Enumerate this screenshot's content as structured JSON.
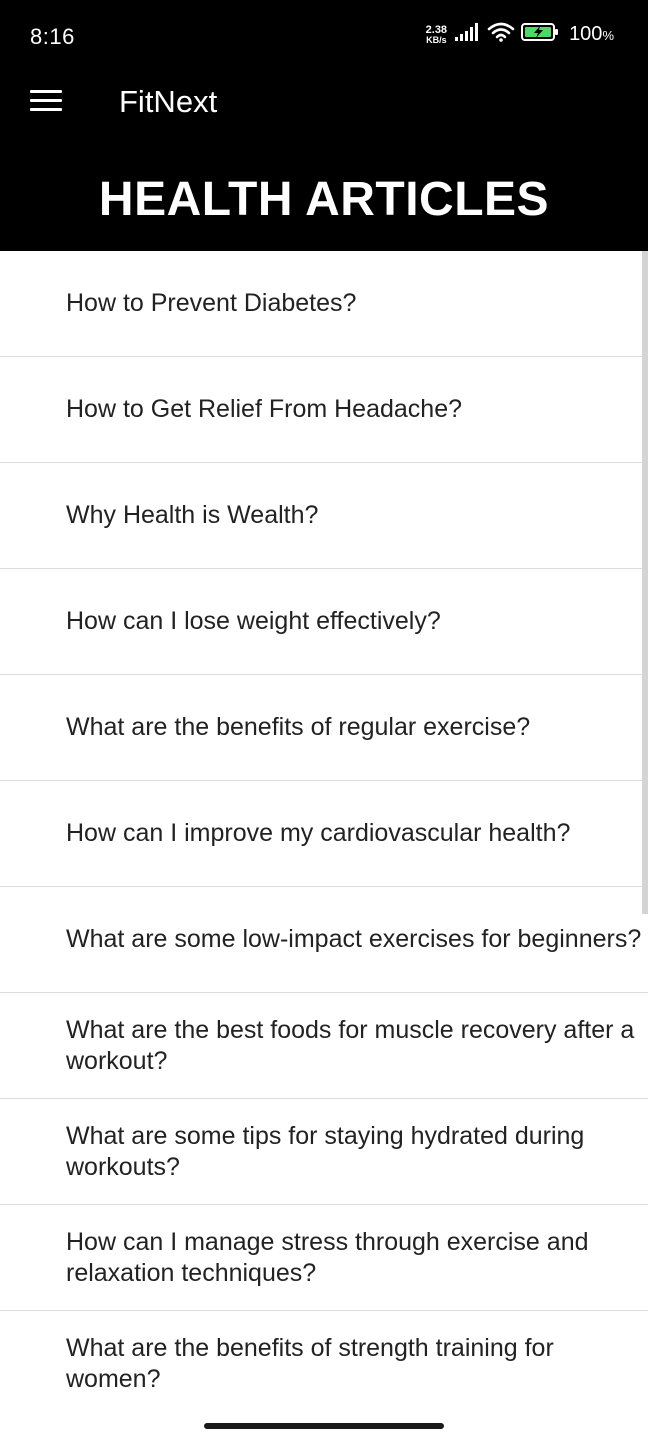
{
  "status_bar": {
    "time": "8:16",
    "net_speed_value": "2.38",
    "net_speed_unit": "KB/s",
    "battery_percent": "100",
    "battery_unit": "%",
    "icons": [
      "signal-icon",
      "wifi-icon",
      "battery-charging-icon"
    ]
  },
  "app_bar": {
    "menu_icon": "hamburger-menu-icon",
    "title": "FitNext"
  },
  "page": {
    "heading": "HEALTH ARTICLES"
  },
  "articles": [
    "How to Prevent Diabetes?",
    "How to Get Relief From Headache?",
    "Why Health is Wealth?",
    "How can I lose weight effectively?",
    "What are the benefits of regular exercise?",
    "How can I improve my cardiovascular health?",
    "What are some low-impact exercises for beginners?",
    "What are the best foods for muscle recovery after a workout?",
    "What are some tips for staying hydrated during workouts?",
    "How can I manage stress through exercise and relaxation techniques?",
    "What are the benefits of strength training for women?"
  ],
  "colors": {
    "header_bg": "#000000",
    "header_text": "#ffffff",
    "list_text": "#222222",
    "divider": "#dddddd"
  }
}
